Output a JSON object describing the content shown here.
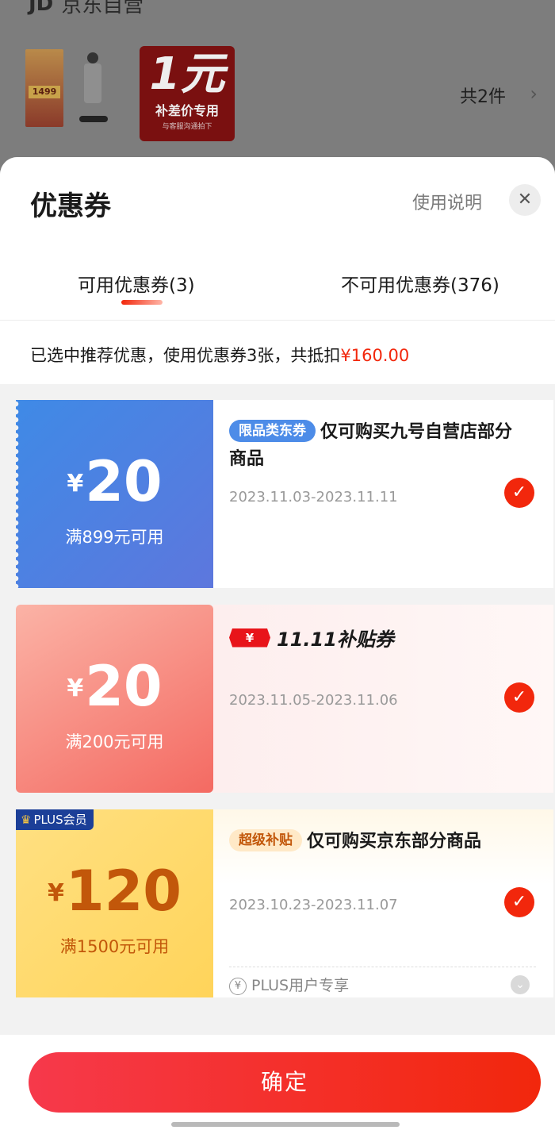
{
  "background": {
    "store_name": "京东自营",
    "product_promo_price": "1499",
    "promo_big": "1元",
    "promo_sub": "补差价专用",
    "promo_tiny": "与客服沟通拍下",
    "item_count": "共2件",
    "chevron": "›"
  },
  "sheet": {
    "title": "优惠券",
    "help_link": "使用说明",
    "close_icon": "✕",
    "tabs": [
      {
        "label": "可用优惠券(3)",
        "active": true
      },
      {
        "label": "不可用优惠券(376)",
        "active": false
      }
    ],
    "summary": {
      "text": "已选中推荐优惠，使用优惠券3张，共抵扣",
      "amount": "¥160.00"
    }
  },
  "coupons": [
    {
      "currency": "¥",
      "amount": "20",
      "condition": "满899元可用",
      "badge": "限品类东券",
      "title": "仅可购买九号自营店部分商品",
      "date": "2023.11.03-2023.11.11",
      "selected": true
    },
    {
      "currency": "¥",
      "amount": "20",
      "condition": "满200元可用",
      "ticket_symbol": "¥",
      "tag_label": "11.11补贴券",
      "date": "2023.11.05-2023.11.06",
      "selected": true
    },
    {
      "corner_badge": "PLUS会员",
      "currency": "¥",
      "amount": "120",
      "condition": "满1500元可用",
      "badge": "超级补贴",
      "title": "仅可购买京东部分商品",
      "date": "2023.10.23-2023.11.07",
      "footer_note": "PLUS用户专享",
      "selected": true
    }
  ],
  "footer": {
    "confirm_label": "确定"
  },
  "colors": {
    "accent": "#f2270c",
    "coupon1": "#4d8ce8",
    "coupon2": "#f46a62",
    "coupon3": "#ffd45a"
  },
  "icons": {
    "check": "check-icon",
    "close": "close-icon",
    "crown": "crown-icon",
    "yen": "yen-circle-icon",
    "chevron": "chevron-down-icon"
  }
}
